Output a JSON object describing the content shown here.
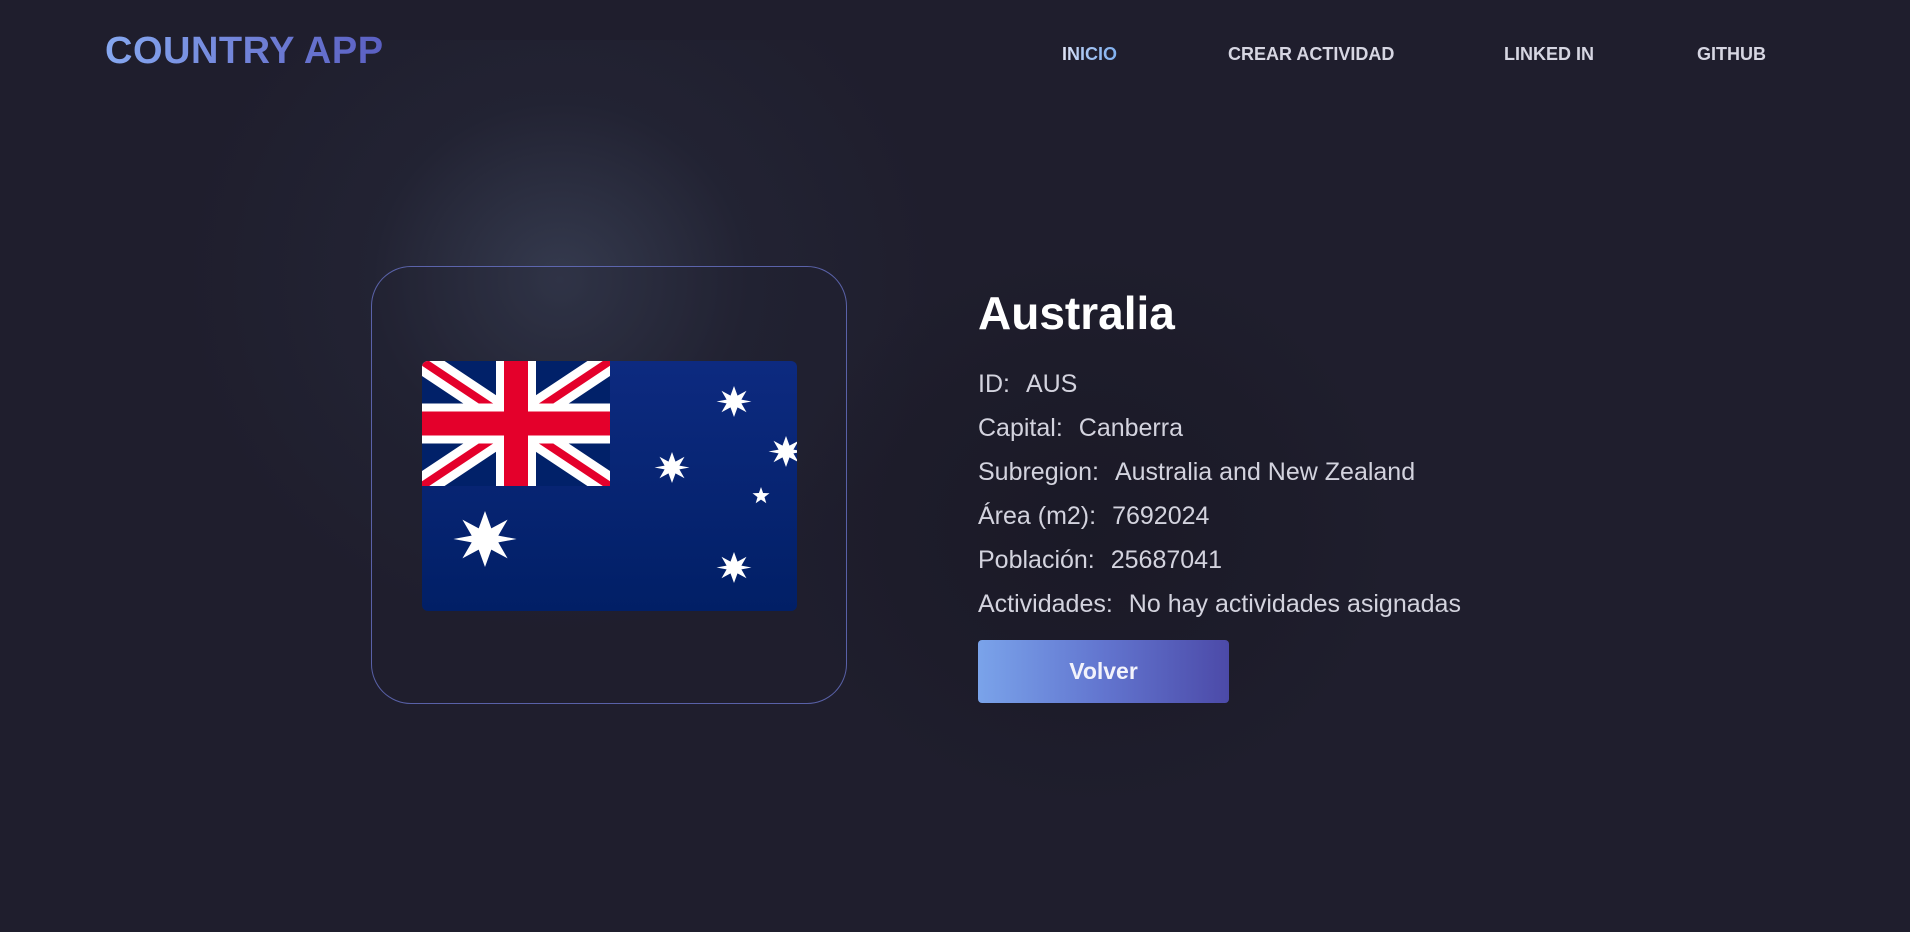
{
  "brand": {
    "logo_text": "COUNTRY APP"
  },
  "nav": {
    "items": [
      {
        "label": "INICIO",
        "active": true
      },
      {
        "label": "CREAR ACTIVIDAD",
        "active": false
      },
      {
        "label": "LINKED IN",
        "active": false
      },
      {
        "label": "GITHUB",
        "active": false
      }
    ]
  },
  "country": {
    "name": "Australia",
    "flag_icon": "australia-flag-icon",
    "fields": [
      {
        "label": "ID:",
        "value": "AUS"
      },
      {
        "label": "Capital:",
        "value": "Canberra"
      },
      {
        "label": "Subregion:",
        "value": "Australia and New Zealand"
      },
      {
        "label": "Área (m2):",
        "value": "7692024"
      },
      {
        "label": "Población:",
        "value": "25687041"
      },
      {
        "label": "Actividades:",
        "value": "No hay actividades asignadas"
      }
    ]
  },
  "actions": {
    "back_label": "Volver"
  },
  "colors": {
    "background": "#1f1e2d",
    "accent_start": "#7aa3ea",
    "accent_end": "#4c4aa8",
    "card_border": "#6e78d2",
    "text_muted": "#d3d3de"
  }
}
